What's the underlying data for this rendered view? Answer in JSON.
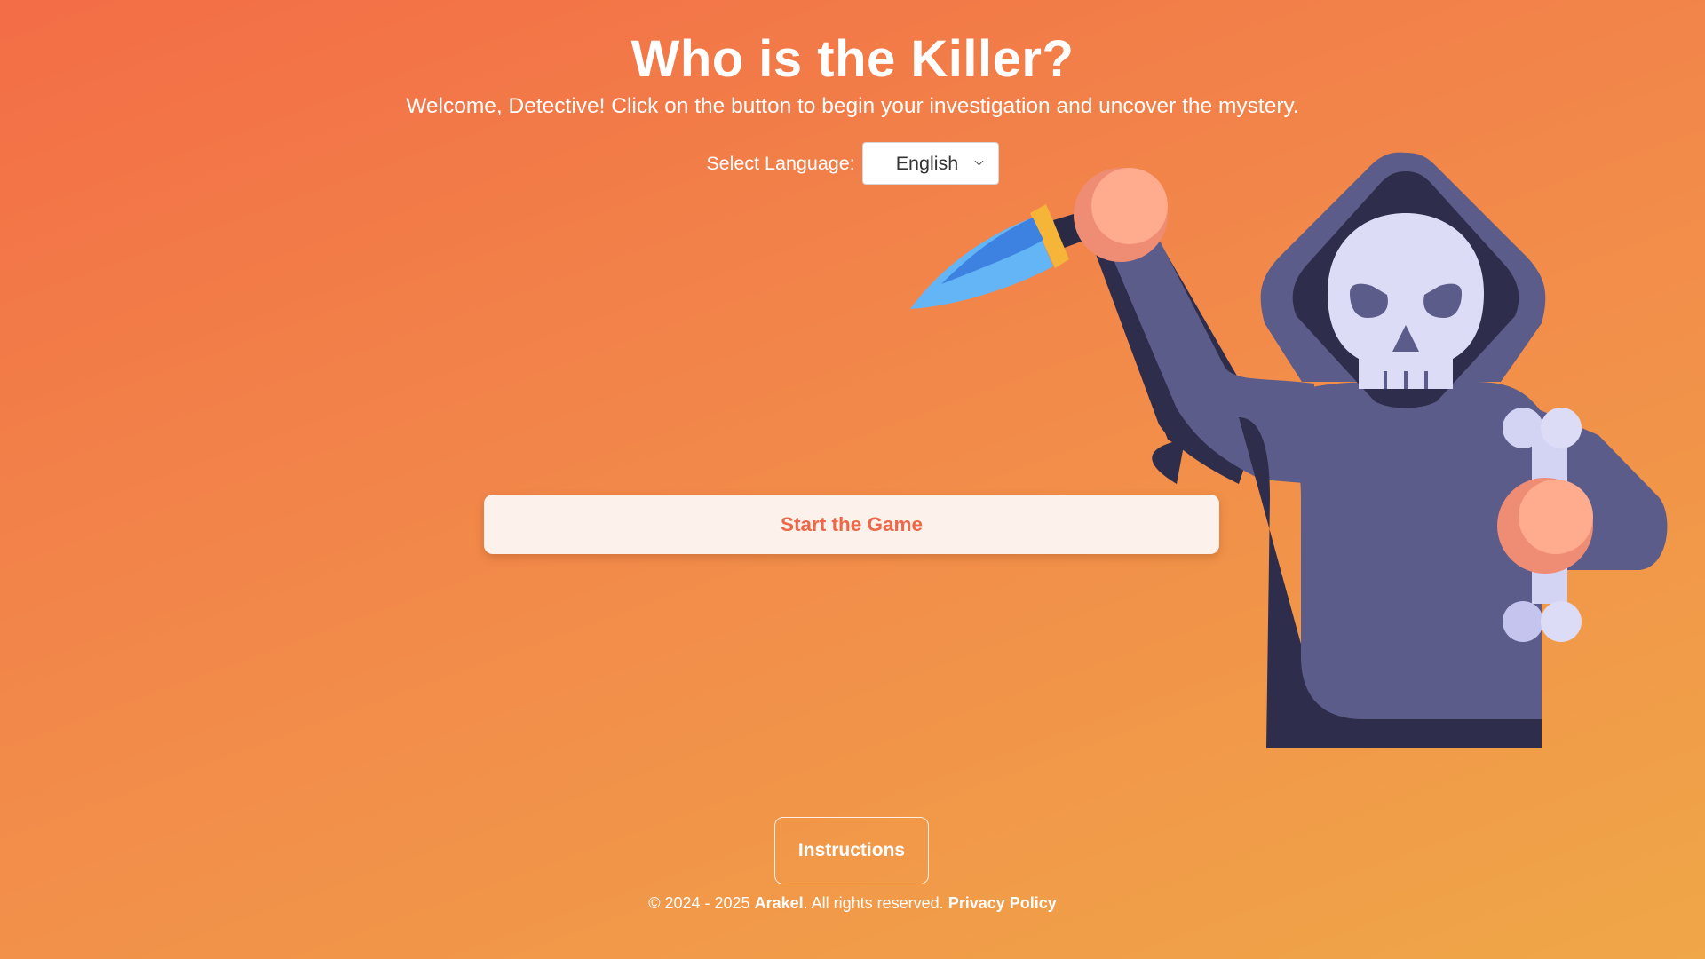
{
  "header": {
    "title": "Who is the Killer?",
    "subtitle": "Welcome, Detective! Click on the button to begin your investigation and uncover the mystery."
  },
  "language": {
    "label": "Select Language:",
    "selected": "English"
  },
  "actions": {
    "start_label": "Start the Game",
    "instructions_label": "Instructions"
  },
  "footer": {
    "copyright": "© 2024 - 2025",
    "brand": "Arakel",
    "rights": ". All rights reserved.",
    "privacy_label": "Privacy Policy"
  },
  "illustration": {
    "name": "hooded-skeleton-killer-icon"
  },
  "colors": {
    "background_start": "#f36d46",
    "background_end": "#f0a748",
    "button_bg": "#fdf1ec",
    "button_text": "#ec6848"
  }
}
